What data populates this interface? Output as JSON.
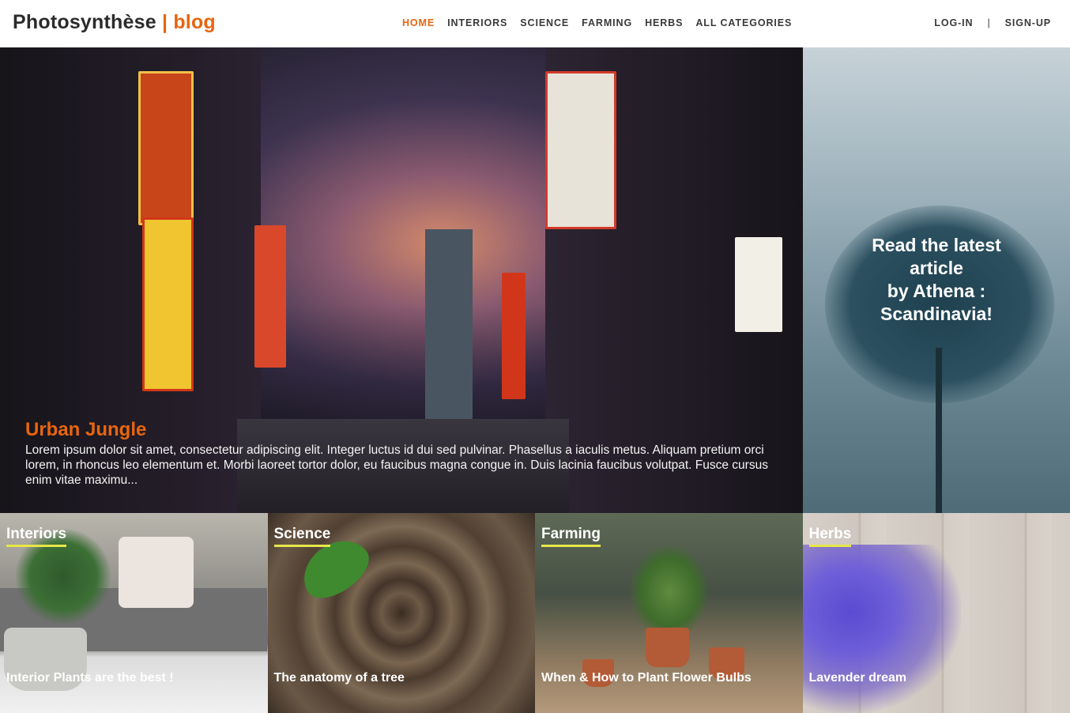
{
  "brand": {
    "name": "Photosynthèse",
    "separator": "|",
    "suffix": "blog"
  },
  "nav": {
    "items": [
      {
        "label": "HOME",
        "active": true
      },
      {
        "label": "INTERIORS",
        "active": false
      },
      {
        "label": "SCIENCE",
        "active": false
      },
      {
        "label": "FARMING",
        "active": false
      },
      {
        "label": "HERBS",
        "active": false
      },
      {
        "label": "ALL CATEGORIES",
        "active": false
      }
    ]
  },
  "auth": {
    "login": "LOG-IN",
    "separator": "|",
    "signup": "SIGN-UP"
  },
  "hero": {
    "title": "Urban Jungle",
    "excerpt": "Lorem ipsum dolor sit amet, consectetur adipiscing elit. Integer luctus id dui sed pulvinar. Phasellus a iaculis metus. Aliquam pretium orci lorem, in rhoncus leo elementum et. Morbi laoreet tortor dolor, eu faucibus magna congue in. Duis lacinia faucibus volutpat. Fusce cursus enim vitae maximu..."
  },
  "side": {
    "line1": "Read the latest",
    "line2": "article",
    "line3": "by Athena :",
    "line4": "Scandinavia!"
  },
  "categories": [
    {
      "label": "Interiors",
      "caption": "Interior Plants are the best !"
    },
    {
      "label": "Science",
      "caption": "The anatomy of a tree"
    },
    {
      "label": "Farming",
      "caption": "When & How to Plant Flower Bulbs"
    },
    {
      "label": "Herbs",
      "caption": "Lavender dream"
    }
  ],
  "colors": {
    "accent": "#e8650f",
    "underline": "#e7e64a",
    "text": "#2b2b2b"
  }
}
